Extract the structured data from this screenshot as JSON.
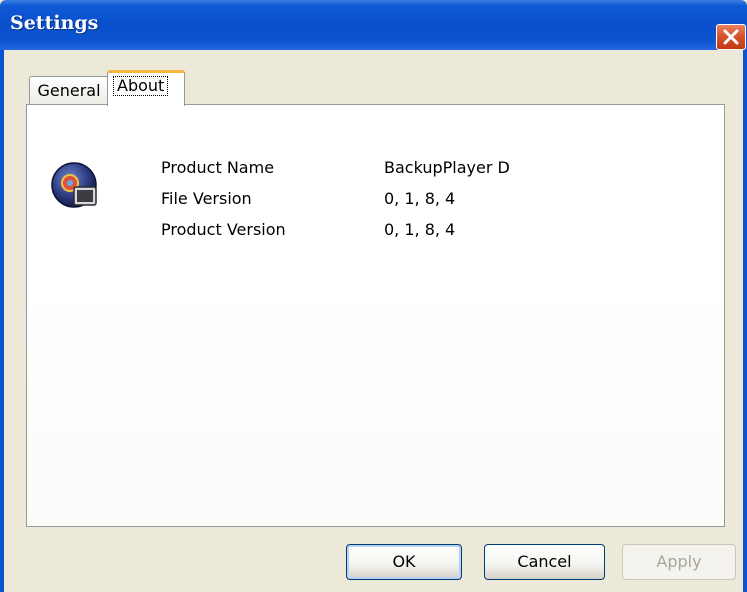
{
  "window": {
    "title": "Settings"
  },
  "tabs": [
    {
      "label": "General"
    },
    {
      "label": "About"
    }
  ],
  "about": {
    "rows": [
      {
        "label": "Product Name",
        "value": "BackupPlayer D"
      },
      {
        "label": "File Version",
        "value": "0, 1, 8, 4"
      },
      {
        "label": "Product Version",
        "value": "0, 1, 8, 4"
      }
    ]
  },
  "buttons": {
    "ok": "OK",
    "cancel": "Cancel",
    "apply": "Apply"
  },
  "icons": {
    "close": "close-icon",
    "app": "backupplayer-app-icon"
  },
  "colors": {
    "titlebar": "#0b53d0",
    "close_button": "#d8502a",
    "active_tab_accent": "#f8b640",
    "dialog_bg": "#ece9d8"
  }
}
